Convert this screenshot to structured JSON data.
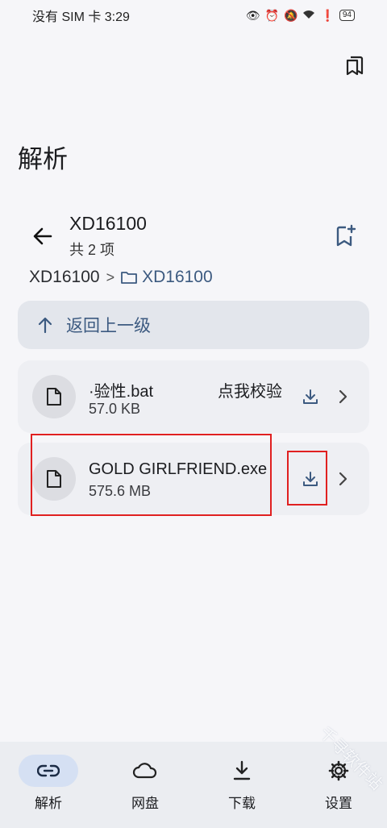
{
  "status_bar": {
    "carrier_time": "没有 SIM 卡 3:29",
    "battery": "94"
  },
  "page": {
    "title": "解析"
  },
  "folder": {
    "name": "XD16100",
    "count": "共 2 项"
  },
  "breadcrumb": {
    "root": "XD16100",
    "separator": ">",
    "current": "XD16100"
  },
  "up_row": {
    "label": "返回上一级"
  },
  "files": [
    {
      "name": "·验性.bat",
      "size": "57.0 KB",
      "verify": "点我校验"
    },
    {
      "name": "GOLD GIRLFRIEND.exe",
      "size": "575.6 MB"
    }
  ],
  "nav": {
    "items": [
      {
        "label": "解析",
        "icon": "link-icon",
        "active": true
      },
      {
        "label": "网盘",
        "icon": "cloud-icon"
      },
      {
        "label": "下载",
        "icon": "download-icon"
      },
      {
        "label": "设置",
        "icon": "gear-icon"
      }
    ]
  },
  "colors": {
    "accent": "#3c5a80",
    "highlight_box": "#e02020",
    "nav_active_pill": "#d5e0f3"
  },
  "watermark": "千寻软件站"
}
